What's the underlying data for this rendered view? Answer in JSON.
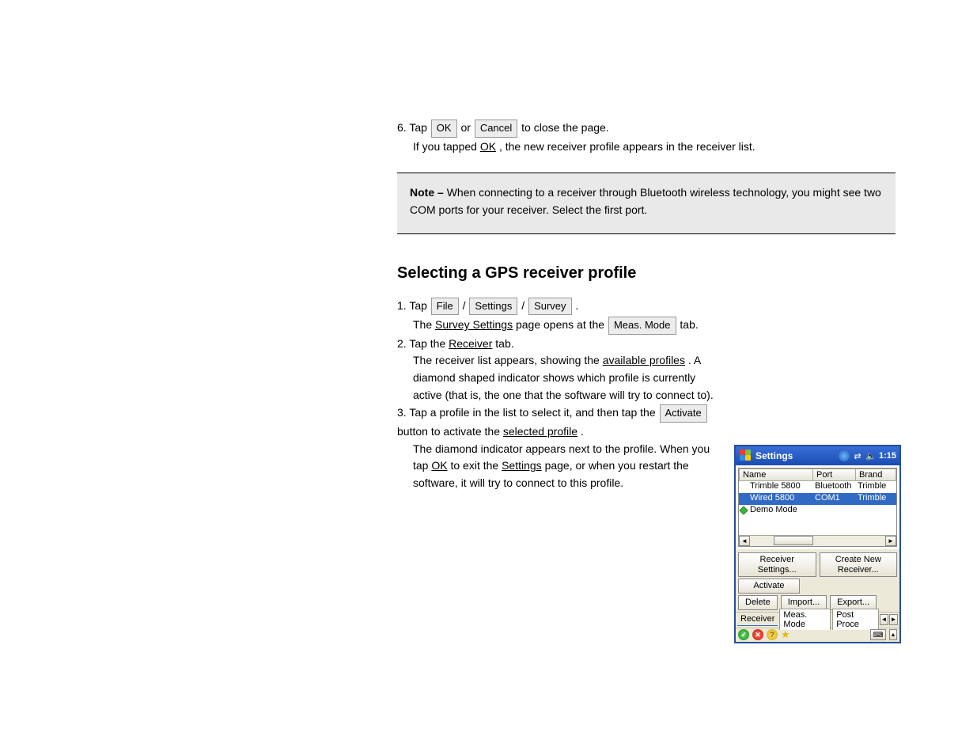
{
  "doc": {
    "p1_pre": "6.  Tap ",
    "p1_btn1": "OK",
    "p1_mid": " or ",
    "p1_btn2": "Cancel",
    "p1_post": " to close the page.",
    "p2_pre": "If you tapped ",
    "p2_ok": "OK",
    "p2_post": ", the new receiver profile appears in the receiver list.",
    "note_label": "Note – ",
    "note_text": "When connecting to a receiver through Bluetooth wireless technology, you might see two COM ports for your receiver. Select the first port.",
    "h2": "Selecting a GPS receiver profile",
    "p3_pre": "1.  Tap ",
    "p3_b1": "File",
    "p3_s1": " / ",
    "p3_b2": "Settings",
    "p3_s2": " / ",
    "p3_b3": "Survey",
    "p3_post": ".",
    "p4_pre": "The ",
    "p4_u": "Survey Settings",
    "p4_mid": " page opens at the ",
    "p4_btn": "Meas. Mode",
    "p4_post": " tab.",
    "p5_pre": "2.  Tap the ",
    "p5_u": "Receiver",
    "p5_post": " tab.",
    "p6_pre": "The receiver list appears, showing the ",
    "p6_u": "available profiles",
    "p6_post": ".  A diamond shaped indicator shows which profile is currently active (that is, the one that the software will try to connect to).",
    "p7_pre": "3.  Tap a profile in the list to select it, and then tap the ",
    "p7_btn": "Activate",
    "p7_mid": " button to activate the ",
    "p7_u": "selected profile",
    "p7_post": ".",
    "p8_pre": "The diamond indicator appears next to the profile. When you tap ",
    "p8_ok": "OK",
    "p8_mid": " to exit the ",
    "p8_u": "Settings",
    "p8_post": " page, or when you restart the software, it will try to connect to this profile."
  },
  "ppc": {
    "title": "Settings",
    "clock": "1:15",
    "columns": {
      "name": "Name",
      "port": "Port",
      "brand": "Brand"
    },
    "rows": [
      {
        "name": "Trimble 5800",
        "port": "Bluetooth",
        "brand": "Trimble",
        "selected": false,
        "active": false
      },
      {
        "name": "Wired 5800",
        "port": "COM1",
        "brand": "Trimble",
        "selected": true,
        "active": false
      },
      {
        "name": "Demo Mode",
        "port": "",
        "brand": "",
        "selected": false,
        "active": true
      }
    ],
    "buttons": {
      "settings": "Receiver Settings...",
      "create": "Create New Receiver...",
      "activate": "Activate",
      "delete": "Delete",
      "import": "Import...",
      "export": "Export..."
    },
    "tabs": {
      "label": "Receiver",
      "t1": "Meas. Mode",
      "t2": "Post Proce"
    }
  }
}
